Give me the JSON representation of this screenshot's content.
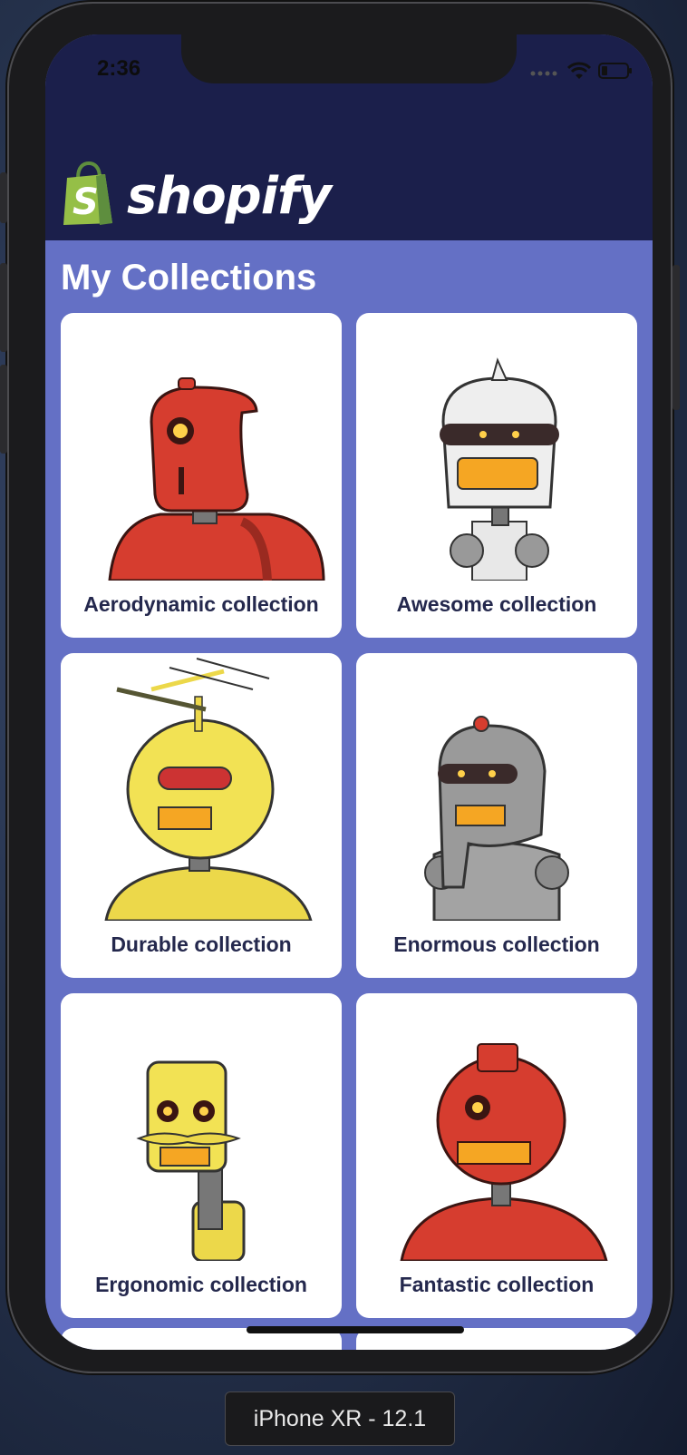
{
  "status_bar": {
    "time": "2:36"
  },
  "brand": {
    "name": "shopify"
  },
  "page": {
    "title": "My Collections"
  },
  "collections": [
    {
      "title": "Aerodynamic collection",
      "image_icon": "red-robot-icon"
    },
    {
      "title": "Awesome collection",
      "image_icon": "white-robot-icon"
    },
    {
      "title": "Durable collection",
      "image_icon": "yellow-antenna-robot-icon"
    },
    {
      "title": "Enormous collection",
      "image_icon": "gray-robot-icon"
    },
    {
      "title": "Ergonomic collection",
      "image_icon": "yellow-mustache-robot-icon"
    },
    {
      "title": "Fantastic collection",
      "image_icon": "red-round-robot-icon"
    }
  ],
  "device": {
    "label": "iPhone XR - 12.1"
  },
  "colors": {
    "navbar": "#1b1f4b",
    "content_bg": "#6470c5",
    "card_bg": "#ffffff",
    "card_text": "#24284d",
    "logo_green": "#95bf47"
  }
}
